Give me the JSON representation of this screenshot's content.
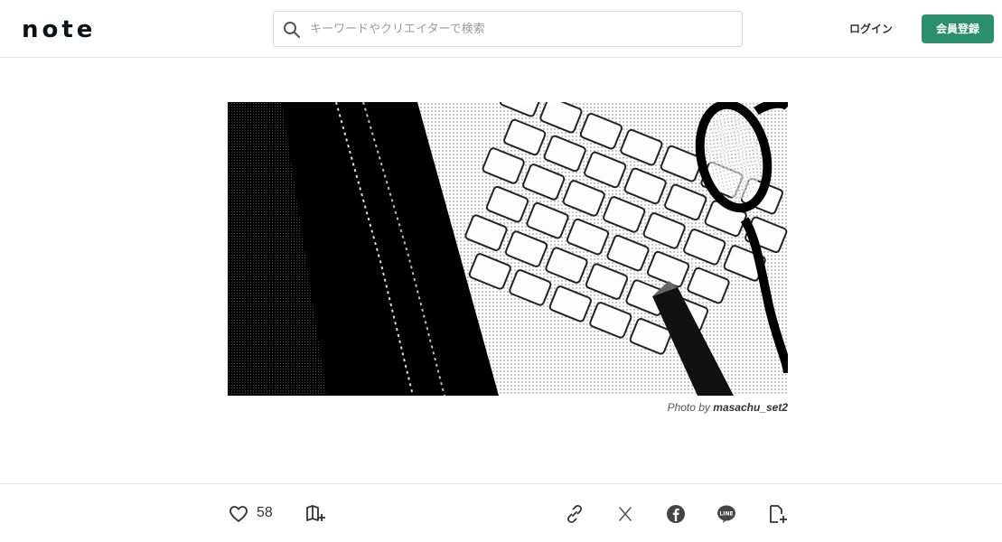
{
  "header": {
    "logo_text": "note",
    "search_placeholder": "キーワードやクリエイターで検索",
    "login_label": "ログイン",
    "signup_label": "会員登録",
    "signup_color": "#2b8f6e"
  },
  "hero": {
    "credit_prefix": "Photo by",
    "credit_author": "masachu_set2"
  },
  "actions": {
    "like_count": "58",
    "left": [
      "heart-icon",
      "magazine-add-icon"
    ],
    "share": [
      "link-icon",
      "x-icon",
      "facebook-icon",
      "line-icon",
      "clip-add-icon"
    ]
  }
}
